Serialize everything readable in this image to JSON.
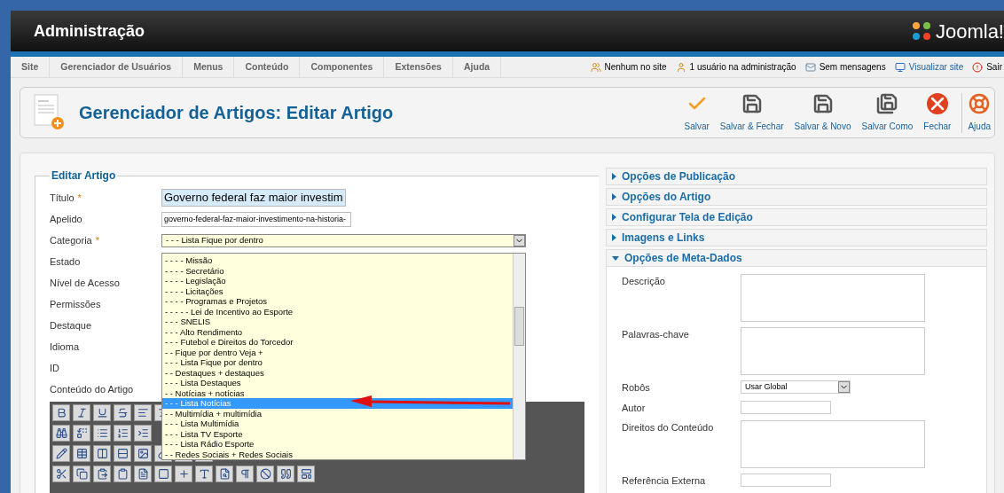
{
  "header": {
    "title": "Administração",
    "logo_text": "Joomla!"
  },
  "menu": [
    {
      "label": "Site"
    },
    {
      "label": "Gerenciador de Usuários"
    },
    {
      "label": "Menus"
    },
    {
      "label": "Conteúdo"
    },
    {
      "label": "Componentes"
    },
    {
      "label": "Extensões"
    },
    {
      "label": "Ajuda"
    }
  ],
  "status": [
    {
      "kind": "users",
      "label": "Nenhum no site"
    },
    {
      "kind": "user",
      "label": "1 usuário na administração"
    },
    {
      "kind": "mail",
      "label": "Sem mensagens"
    },
    {
      "kind": "view",
      "label": "Visualizar site"
    },
    {
      "kind": "logout",
      "label": "Sair"
    }
  ],
  "toolbar": {
    "title": "Gerenciador de Artigos: Editar Artigo",
    "buttons": [
      {
        "kind": "save",
        "label": "Salvar"
      },
      {
        "kind": "save-close",
        "label": "Salvar & Fechar"
      },
      {
        "kind": "save-new",
        "label": "Salvar & Novo"
      },
      {
        "kind": "save-copy",
        "label": "Salvar Como"
      },
      {
        "kind": "close",
        "label": "Fechar"
      },
      {
        "kind": "help",
        "label": "Ajuda"
      }
    ]
  },
  "form": {
    "legend": "Editar Artigo",
    "required_mark": "*",
    "fields": [
      {
        "label": "Título",
        "required": true,
        "kind": "title",
        "value": "Governo federal faz maior investim"
      },
      {
        "label": "Apelido",
        "required": false,
        "kind": "text",
        "value": "governo-federal-faz-maior-investimento-na-historia-"
      },
      {
        "label": "Categoria",
        "required": true,
        "kind": "select",
        "value": "- - - Lista Fique por dentro"
      },
      {
        "label": "Estado",
        "required": false,
        "kind": "hidden"
      },
      {
        "label": "Nível de Acesso",
        "required": false,
        "kind": "hidden"
      },
      {
        "label": "Permissões",
        "required": false,
        "kind": "hidden"
      },
      {
        "label": "Destaque",
        "required": false,
        "kind": "hidden"
      },
      {
        "label": "Idioma",
        "required": false,
        "kind": "hidden"
      },
      {
        "label": "ID",
        "required": false,
        "kind": "hidden"
      },
      {
        "label": "Conteúdo do Artigo",
        "required": false,
        "kind": "hidden"
      }
    ],
    "category_options": [
      {
        "label": "- - - - Missão",
        "selected": false
      },
      {
        "label": "- - - - Secretário",
        "selected": false
      },
      {
        "label": "- - - - Legislação",
        "selected": false
      },
      {
        "label": "- - - - Licitações",
        "selected": false
      },
      {
        "label": "- - - - Programas e Projetos",
        "selected": false
      },
      {
        "label": "- - - - - Lei de Incentivo ao Esporte",
        "selected": false
      },
      {
        "label": "- - - SNELIS",
        "selected": false
      },
      {
        "label": "- - - Alto Rendimento",
        "selected": false
      },
      {
        "label": "- - - Futebol e Direitos do Torcedor",
        "selected": false
      },
      {
        "label": "- - Fique por dentro Veja +",
        "selected": false
      },
      {
        "label": "- - - Lista Fique por dentro",
        "selected": false
      },
      {
        "label": "- - Destaques + destaques",
        "selected": false
      },
      {
        "label": "- - - Lista Destaques",
        "selected": false
      },
      {
        "label": "- - Notícias + notícias",
        "selected": false
      },
      {
        "label": "- - - Lista Notícias",
        "selected": true
      },
      {
        "label": "- - Multimídia + multimídia",
        "selected": false
      },
      {
        "label": "- - - Lista Multimídia",
        "selected": false
      },
      {
        "label": "- - - Lista TV Esporte",
        "selected": false
      },
      {
        "label": "- - - Lista Rádio Esporte",
        "selected": false
      },
      {
        "label": "- - Redes Sociais + Redes Sociais",
        "selected": false
      }
    ]
  },
  "panels": [
    {
      "title": "Opções de Publicação",
      "expanded": false
    },
    {
      "title": "Opções do Artigo",
      "expanded": false
    },
    {
      "title": "Configurar Tela de Edição",
      "expanded": false
    },
    {
      "title": "Imagens e Links",
      "expanded": false
    },
    {
      "title": "Opções de Meta-Dados",
      "expanded": true
    }
  ],
  "meta_fields": [
    {
      "label": "Descrição",
      "kind": "textarea"
    },
    {
      "label": "Palavras-chave",
      "kind": "textarea"
    },
    {
      "label": "Robôs",
      "kind": "select",
      "value": "Usar Global"
    },
    {
      "label": "Autor",
      "kind": "input"
    },
    {
      "label": "Direitos do Conteúdo",
      "kind": "textarea"
    },
    {
      "label": "Referência Externa",
      "kind": "input"
    }
  ]
}
